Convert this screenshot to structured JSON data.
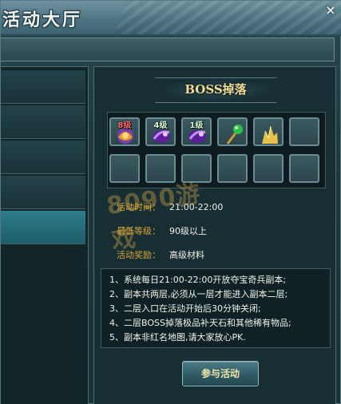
{
  "window": {
    "title": "活动大厅",
    "close_glyph": "×"
  },
  "boss_panel": {
    "title": "BOSS掉落",
    "drop_slots": [
      {
        "level": "8级",
        "level_color": "red",
        "icon": "orange-purple-orb-icon"
      },
      {
        "level": "4级",
        "level_color": "green",
        "icon": "purple-gem-icon"
      },
      {
        "level": "1级",
        "level_color": "green",
        "icon": "purple-gem-icon"
      },
      {
        "level": "",
        "level_color": "",
        "icon": "green-jade-staff-icon"
      },
      {
        "level": "",
        "level_color": "",
        "icon": "gold-crystal-ore-icon"
      },
      {
        "level": "",
        "level_color": "",
        "icon": "empty"
      },
      {
        "level": "",
        "level_color": "",
        "icon": "empty"
      },
      {
        "level": "",
        "level_color": "",
        "icon": "empty"
      },
      {
        "level": "",
        "level_color": "",
        "icon": "empty"
      },
      {
        "level": "",
        "level_color": "",
        "icon": "empty"
      },
      {
        "level": "",
        "level_color": "",
        "icon": "empty"
      },
      {
        "level": "",
        "level_color": "",
        "icon": "empty"
      }
    ],
    "info": {
      "time_label": "活动时间：",
      "time_value": "21:00-22:00",
      "level_label": "最低等级：",
      "level_value": "90级以上",
      "reward_label": "活动奖励：",
      "reward_value": "高级材料"
    },
    "notes": [
      "1、系统每日21:00-22:00开放夺宝奇兵副本;",
      "2、副本共两层,必须从一层才能进入副本二层;",
      "3、二层入口在活动开始后30分钟关闭;",
      "4、二层BOSS掉落极品补天石和其他稀有物品;",
      "5、副本非红名地图,请大家放心PK."
    ],
    "join_button": "参与活动"
  },
  "watermark": "8090游戏",
  "colors": {
    "label_orange": "#d9a43a",
    "title_gold": "#f0dc9a",
    "panel_bg": "#172e33",
    "selected_item": "#2e7c8c"
  }
}
